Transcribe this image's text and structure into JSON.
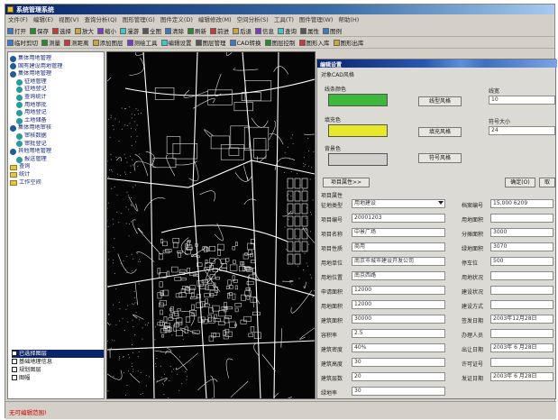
{
  "window": {
    "title": "系统管理系统"
  },
  "menu": {
    "items": [
      "文件(F)",
      "编辑(E)",
      "视图(V)",
      "查询分析(Q)",
      "图形管理(G)",
      "图件定义(D)",
      "编辑修改(M)",
      "空间分析(S)",
      "工具(T)",
      "图件管理(W)",
      "帮助(H)"
    ]
  },
  "toolbar1": {
    "items": [
      "打开",
      "保存",
      "选择",
      "放大",
      "缩小",
      "漫游",
      "全图",
      "清除",
      "刷新",
      "前进",
      "后退",
      "信息",
      "查询",
      "属性",
      "图例"
    ]
  },
  "toolbar2": {
    "items": [
      "临时剪切",
      "测量",
      "测距离",
      "添加图层",
      "测绘工具",
      "编辑设置",
      "图层管理",
      "CAD转换",
      "图层控制",
      "图形入库",
      "图形出库"
    ]
  },
  "tree": {
    "items": [
      {
        "label": "集体用地管理",
        "kind": "node",
        "indent": 0,
        "color": "#1f5a9a"
      },
      {
        "label": "国有建设用地管理",
        "kind": "node",
        "indent": 0,
        "color": "#1f5a9a"
      },
      {
        "label": "集体用地管理",
        "kind": "node",
        "indent": 0,
        "color": "#1f5a9a"
      },
      {
        "label": "征地管理",
        "kind": "node",
        "indent": 1,
        "color": "#2a9a9a"
      },
      {
        "label": "征地登记",
        "kind": "node",
        "indent": 1,
        "color": "#2a9a9a"
      },
      {
        "label": "查询统计",
        "kind": "node",
        "indent": 1,
        "color": "#2a9a9a"
      },
      {
        "label": "用地审批",
        "kind": "node",
        "indent": 1,
        "color": "#2a9a9a"
      },
      {
        "label": "用地登记",
        "kind": "node",
        "indent": 1,
        "color": "#2a9a9a"
      },
      {
        "label": "土地储备",
        "kind": "node",
        "indent": 1,
        "color": "#2a9a9a"
      },
      {
        "label": "集体用地审核",
        "kind": "node",
        "indent": 0,
        "color": "#1f5a9a"
      },
      {
        "label": "审核数据",
        "kind": "node",
        "indent": 1,
        "color": "#2a9a9a"
      },
      {
        "label": "审批登记",
        "kind": "node",
        "indent": 1,
        "color": "#2a9a9a"
      },
      {
        "label": "其他用地管理",
        "kind": "node",
        "indent": 0,
        "color": "#1f5a9a"
      },
      {
        "label": "报送管理",
        "kind": "node",
        "indent": 1,
        "color": "#2a9a9a"
      },
      {
        "label": "查询",
        "kind": "folder",
        "indent": 0,
        "color": "#e6c34a"
      },
      {
        "label": "统计",
        "kind": "folder",
        "indent": 0,
        "color": "#e6c34a"
      },
      {
        "label": "工作空间",
        "kind": "folder",
        "indent": 0,
        "color": "#e6c34a"
      }
    ]
  },
  "layers": {
    "items": [
      {
        "label": "已选择图层",
        "selected": true
      },
      {
        "label": "基础地理信息",
        "selected": false
      },
      {
        "label": "规划图层",
        "selected": false
      },
      {
        "label": "图幅",
        "selected": false
      }
    ]
  },
  "dialog": {
    "title": "编辑设置",
    "cad_option": "对象CAD风格",
    "line_color_label": "线条颜色",
    "line_color": "#3db83d",
    "line_color_button": "线型风格",
    "fill_color_label": "填充色",
    "fill_color": "#e8e82a",
    "fill_button": "填充风格",
    "bg_color_label": "背景色",
    "bg_color": "#cfcfcf",
    "text_button": "符号风格",
    "width_label": "线宽",
    "width_value": "10",
    "symbol_size_label": "符号大小",
    "symbol_size_value": "24",
    "props_button": "项目属性>>",
    "ok_button": "确定(O)",
    "cancel_button": "取",
    "group_label": "项目属性",
    "left_rows": [
      {
        "label": "征地类型",
        "value": "用地建设",
        "dropdown": true
      },
      {
        "label": "项目编号",
        "value": "20001203"
      },
      {
        "label": "项目名称",
        "value": "中景广场"
      },
      {
        "label": "项目性质",
        "value": "商用"
      },
      {
        "label": "用地单位",
        "value": "南京市城市建设开发公司"
      },
      {
        "label": "用地位置",
        "value": "南京西路"
      },
      {
        "label": "申请面积",
        "value": "12000"
      },
      {
        "label": "用地面积",
        "value": "12000"
      },
      {
        "label": "建筑面积",
        "value": "30000"
      },
      {
        "label": "容积率",
        "value": "2.5"
      },
      {
        "label": "建筑密度",
        "value": "40%"
      },
      {
        "label": "建筑高度",
        "value": "30"
      },
      {
        "label": "建筑层数",
        "value": "20"
      },
      {
        "label": "绿地率",
        "value": "30"
      }
    ],
    "right_rows": [
      {
        "label": "档案编号",
        "value": "15,000 6209"
      },
      {
        "label": "用地面积",
        "value": ""
      },
      {
        "label": "分摊面积",
        "value": "3000"
      },
      {
        "label": "绿地面积",
        "value": "3070"
      },
      {
        "label": "停车位",
        "value": "500"
      },
      {
        "label": "用地状况",
        "value": ""
      },
      {
        "label": "建设状况",
        "value": ""
      },
      {
        "label": "建设方式",
        "value": ""
      },
      {
        "label": "签发日期",
        "value": "2003年12月28日"
      },
      {
        "label": "办理人员",
        "value": ""
      },
      {
        "label": "出让日期",
        "value": "2003年 6 月28日"
      },
      {
        "label": "许可证号",
        "value": ""
      },
      {
        "label": "发证日期",
        "value": "2003年 6 月28日"
      }
    ]
  },
  "status": {
    "text": "无可编辑范围!"
  }
}
